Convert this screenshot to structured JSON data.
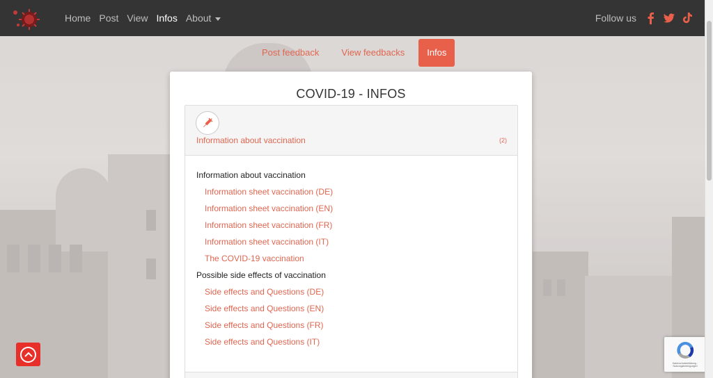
{
  "colors": {
    "accent": "#e8604a",
    "navbar": "#343434",
    "link": "#e06650"
  },
  "navbar": {
    "logo_icon": "coronavirus-logo",
    "links": [
      {
        "label": "Home",
        "active": false
      },
      {
        "label": "Post",
        "active": false
      },
      {
        "label": "View",
        "active": false
      },
      {
        "label": "Infos",
        "active": true
      },
      {
        "label": "About",
        "active": false
      }
    ],
    "follow_label": "Follow us",
    "social": [
      "facebook-icon",
      "twitter-icon",
      "tiktok-icon"
    ]
  },
  "subnav": {
    "tabs": [
      {
        "label": "Post feedback"
      },
      {
        "label": "View feedbacks"
      },
      {
        "label": "Infos"
      }
    ]
  },
  "card": {
    "title": "COVID-19 - INFOS",
    "panel": {
      "icon": "syringe-icon",
      "title": "Information about vaccination",
      "count": "(2)",
      "sections": [
        {
          "heading": "Information about vaccination",
          "links": [
            "Information sheet vaccination (DE)",
            "Information sheet vaccination (EN)",
            "Information sheet vaccination (FR)",
            "Information sheet vaccination (IT)",
            "The COVID-19 vaccination"
          ]
        },
        {
          "heading": "Possible side effects of vaccination",
          "links": [
            "Side effects and Questions (DE)",
            "Side effects and Questions (EN)",
            "Side effects and Questions (FR)",
            "Side effects and Questions (IT)"
          ]
        }
      ]
    }
  },
  "back_to_top_icon": "chevron-up-icon",
  "recaptcha": {
    "icon": "recaptcha-icon",
    "text": "Datenschutzerklärung - Nutzungsbedingungen"
  }
}
